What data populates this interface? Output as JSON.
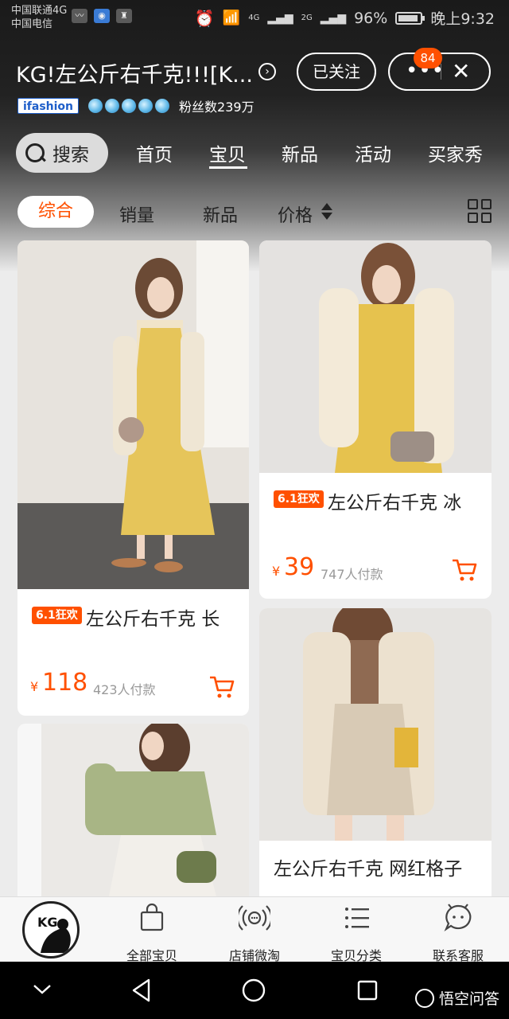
{
  "status_bar": {
    "carrier_1": "中国联通4G",
    "carrier_2": "中国电信",
    "signal_1": "4G",
    "signal_2": "2G",
    "battery_percent": "96%",
    "time": "晚上9:32"
  },
  "header": {
    "shop_name": "KG!左公斤右千克!!![K...",
    "follow_label": "已关注",
    "notification_count": "84",
    "brand_badge": "ifashion",
    "crown_count": 5,
    "fans_text": "粉丝数239万"
  },
  "nav": {
    "search_label": "搜索",
    "tabs": [
      {
        "label": "首页",
        "active": false
      },
      {
        "label": "宝贝",
        "active": true
      },
      {
        "label": "新品",
        "active": false
      },
      {
        "label": "活动",
        "active": false
      },
      {
        "label": "买家秀",
        "active": false
      }
    ]
  },
  "sort": {
    "items": [
      "综合",
      "销量",
      "新品",
      "价格"
    ],
    "active": "综合"
  },
  "products": [
    {
      "promo_tag": "6.1狂欢",
      "title": "左公斤右千克 长",
      "currency": "¥",
      "price": "118",
      "sold": "423人付款"
    },
    {
      "promo_tag": "6.1狂欢",
      "title": "左公斤右千克 冰",
      "currency": "¥",
      "price": "39",
      "sold": "747人付款"
    },
    {
      "promo_tag": "",
      "title": "",
      "currency": "",
      "price": "",
      "sold": ""
    },
    {
      "promo_tag": "",
      "title": "左公斤右千克 网红格子",
      "currency": "",
      "price": "",
      "sold": ""
    }
  ],
  "shop_bar": {
    "logo_text": "KG",
    "items": [
      {
        "label": "全部宝贝",
        "icon": "bag-icon"
      },
      {
        "label": "店铺微淘",
        "icon": "broadcast-icon"
      },
      {
        "label": "宝贝分类",
        "icon": "category-list-icon"
      },
      {
        "label": "联系客服",
        "icon": "chat-icon"
      }
    ]
  },
  "watermark": "悟空问答",
  "colors": {
    "accent": "#ff5000",
    "header_bg": "#1a1a1a"
  }
}
